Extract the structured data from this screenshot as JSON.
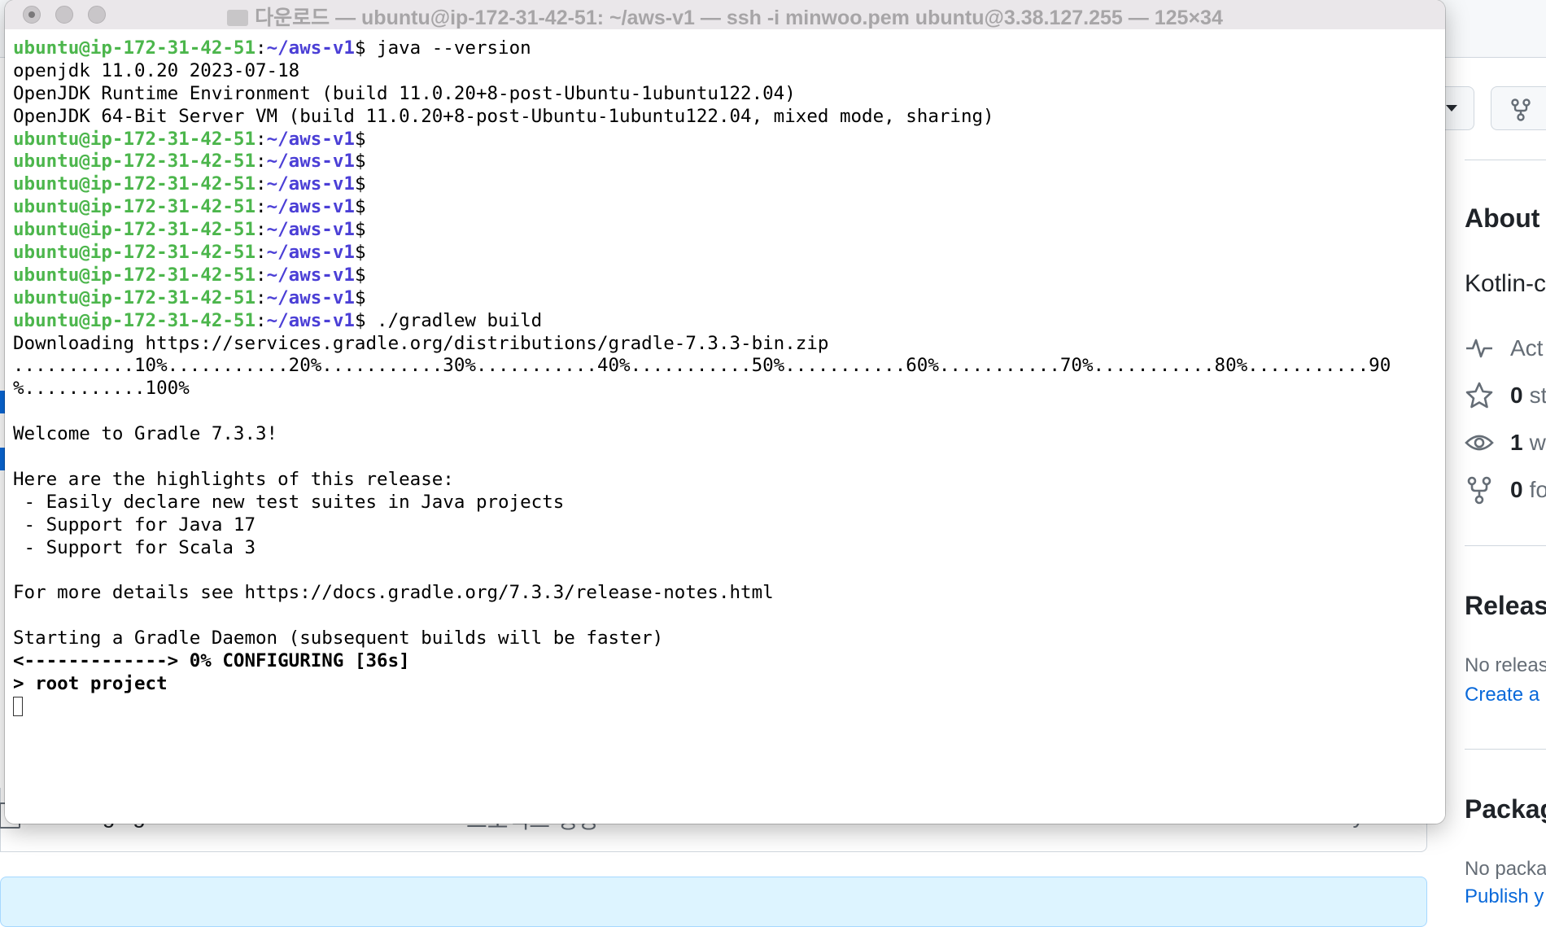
{
  "terminal": {
    "title": "다운로드 — ubuntu@ip-172-31-42-51: ~/aws-v1 — ssh -i minwoo.pem ubuntu@3.38.127.255 — 125×34",
    "prompt": {
      "user_host": "ubuntu@ip-172-31-42-51",
      "sep": ":",
      "path": "~/aws-v1",
      "symbol": "$"
    },
    "lines": [
      {
        "kind": "prompt",
        "cmd": " java --version"
      },
      {
        "kind": "out",
        "text": "openjdk 11.0.20 2023-07-18"
      },
      {
        "kind": "out",
        "text": "OpenJDK Runtime Environment (build 11.0.20+8-post-Ubuntu-1ubuntu122.04)"
      },
      {
        "kind": "out",
        "text": "OpenJDK 64-Bit Server VM (build 11.0.20+8-post-Ubuntu-1ubuntu122.04, mixed mode, sharing)"
      },
      {
        "kind": "prompt",
        "cmd": ""
      },
      {
        "kind": "prompt",
        "cmd": ""
      },
      {
        "kind": "prompt",
        "cmd": ""
      },
      {
        "kind": "prompt",
        "cmd": ""
      },
      {
        "kind": "prompt",
        "cmd": ""
      },
      {
        "kind": "prompt",
        "cmd": ""
      },
      {
        "kind": "prompt",
        "cmd": ""
      },
      {
        "kind": "prompt",
        "cmd": ""
      },
      {
        "kind": "prompt",
        "cmd": " ./gradlew build"
      },
      {
        "kind": "out",
        "text": "Downloading https://services.gradle.org/distributions/gradle-7.3.3-bin.zip"
      },
      {
        "kind": "out",
        "text": "...........10%...........20%...........30%...........40%...........50%...........60%...........70%...........80%...........90"
      },
      {
        "kind": "out",
        "text": "%...........100%"
      },
      {
        "kind": "out",
        "text": ""
      },
      {
        "kind": "out",
        "text": "Welcome to Gradle 7.3.3!"
      },
      {
        "kind": "out",
        "text": ""
      },
      {
        "kind": "out",
        "text": "Here are the highlights of this release:"
      },
      {
        "kind": "out",
        "text": " - Easily declare new test suites in Java projects"
      },
      {
        "kind": "out",
        "text": " - Support for Java 17"
      },
      {
        "kind": "out",
        "text": " - Support for Scala 3"
      },
      {
        "kind": "out",
        "text": ""
      },
      {
        "kind": "out",
        "text": "For more details see https://docs.gradle.org/7.3.3/release-notes.html"
      },
      {
        "kind": "out",
        "text": ""
      },
      {
        "kind": "out",
        "text": "Starting a Gradle Daemon (subsequent builds will be faster)"
      },
      {
        "kind": "bold",
        "text": "<-------------> 0% CONFIGURING [36s]"
      },
      {
        "kind": "bold",
        "text": "> root project"
      },
      {
        "kind": "cursor",
        "text": ""
      }
    ]
  },
  "github": {
    "about_title": "About",
    "about_desc": "Kotlin-c",
    "stats": [
      {
        "icon": "pulse-icon",
        "num": "",
        "label": "Act"
      },
      {
        "icon": "star-icon",
        "num": "0",
        "label": "st"
      },
      {
        "icon": "eye-icon",
        "num": "1",
        "label": "wa"
      },
      {
        "icon": "fork-icon",
        "num": "0",
        "label": "fo"
      }
    ],
    "releases_title": "Releas",
    "releases_none": "No releas",
    "releases_link": "Create a",
    "packages_title": "Packag",
    "packages_none": "No packa",
    "packages_link": "Publish y",
    "file_row": {
      "name": "settings.gradle",
      "message": "프로젝트 생성",
      "age": "last year"
    }
  }
}
